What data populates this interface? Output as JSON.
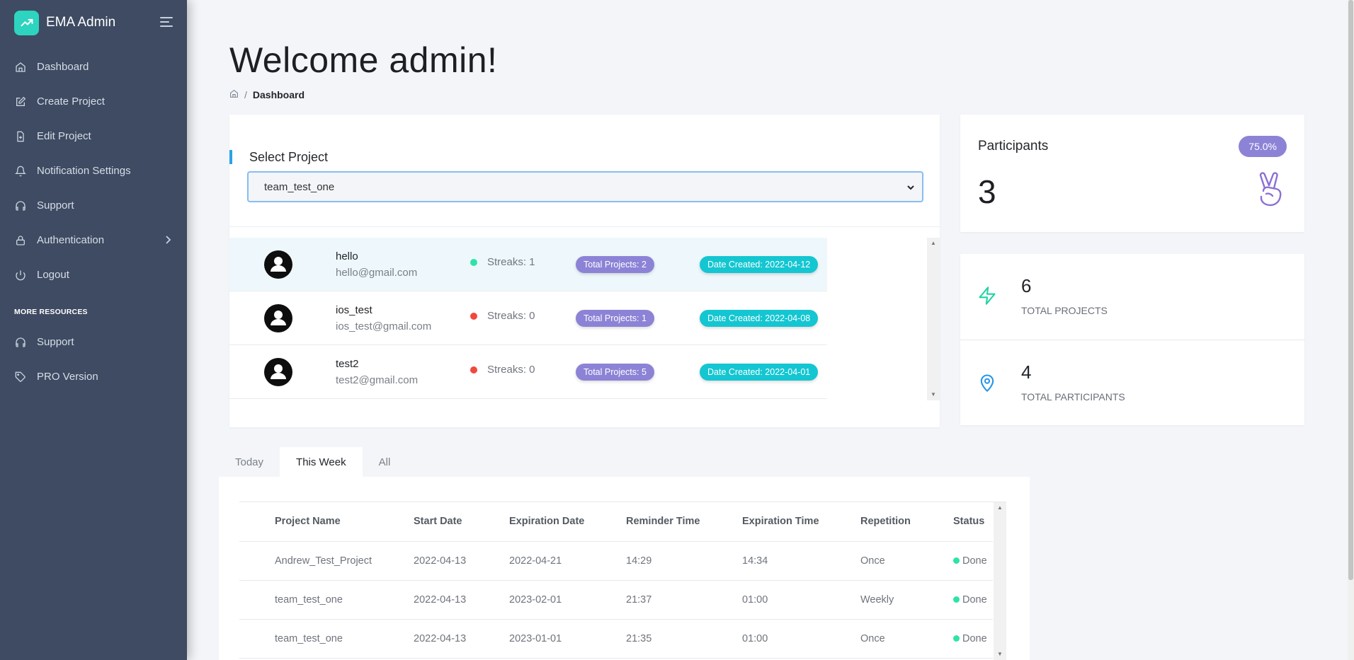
{
  "app": {
    "name": "EMA Admin"
  },
  "sidebar": {
    "items": [
      {
        "label": "Dashboard",
        "icon": "home-icon"
      },
      {
        "label": "Create Project",
        "icon": "edit-icon"
      },
      {
        "label": "Edit Project",
        "icon": "file-plus-icon"
      },
      {
        "label": "Notification Settings",
        "icon": "bell-icon"
      },
      {
        "label": "Support",
        "icon": "headphones-icon"
      },
      {
        "label": "Authentication",
        "icon": "lock-icon"
      },
      {
        "label": "Logout",
        "icon": "power-icon"
      }
    ],
    "resources_heading": "MORE RESOURCES",
    "resources": [
      {
        "label": "Support",
        "icon": "headphones-icon"
      },
      {
        "label": "PRO Version",
        "icon": "tag-icon"
      }
    ]
  },
  "page": {
    "title": "Welcome admin!",
    "breadcrumb_current": "Dashboard"
  },
  "project_selector": {
    "label": "Select Project",
    "selected": "team_test_one"
  },
  "users": [
    {
      "name": "hello",
      "email": "hello@gmail.com",
      "streaks": "Streaks: 1",
      "streak_color": "#2ee3a8",
      "projects": "Total Projects: 2",
      "created": "Date Created: 2022-04-12"
    },
    {
      "name": "ios_test",
      "email": "ios_test@gmail.com",
      "streaks": "Streaks: 0",
      "streak_color": "#f0493e",
      "projects": "Total Projects: 1",
      "created": "Date Created: 2022-04-08"
    },
    {
      "name": "test2",
      "email": "test2@gmail.com",
      "streaks": "Streaks: 0",
      "streak_color": "#f0493e",
      "projects": "Total Projects: 5",
      "created": "Date Created: 2022-04-01"
    }
  ],
  "participants": {
    "title": "Participants",
    "count": "3",
    "percent": "75.0%"
  },
  "stats": [
    {
      "value": "6",
      "label": "TOTAL PROJECTS",
      "icon": "zap-icon"
    },
    {
      "value": "4",
      "label": "TOTAL PARTICIPANTS",
      "icon": "map-pin-icon"
    }
  ],
  "tabs": [
    "Today",
    "This Week",
    "All"
  ],
  "active_tab": "This Week",
  "table": {
    "headers": [
      "Project Name",
      "Start Date",
      "Expiration Date",
      "Reminder Time",
      "Expiration Time",
      "Repetition",
      "Status"
    ],
    "rows": [
      [
        "Andrew_Test_Project",
        "2022-04-13",
        "2022-04-21",
        "14:29",
        "14:34",
        "Once",
        "Done"
      ],
      [
        "team_test_one",
        "2022-04-13",
        "2023-02-01",
        "21:37",
        "01:00",
        "Weekly",
        "Done"
      ],
      [
        "team_test_one",
        "2022-04-13",
        "2023-01-01",
        "21:35",
        "01:00",
        "Once",
        "Done"
      ]
    ]
  },
  "colors": {
    "sidebar": "#3e4b62",
    "accent_purple": "#8c83d6",
    "accent_cyan": "#14c6d1",
    "accent_green": "#2ee3a8",
    "accent_red": "#f0493e"
  }
}
